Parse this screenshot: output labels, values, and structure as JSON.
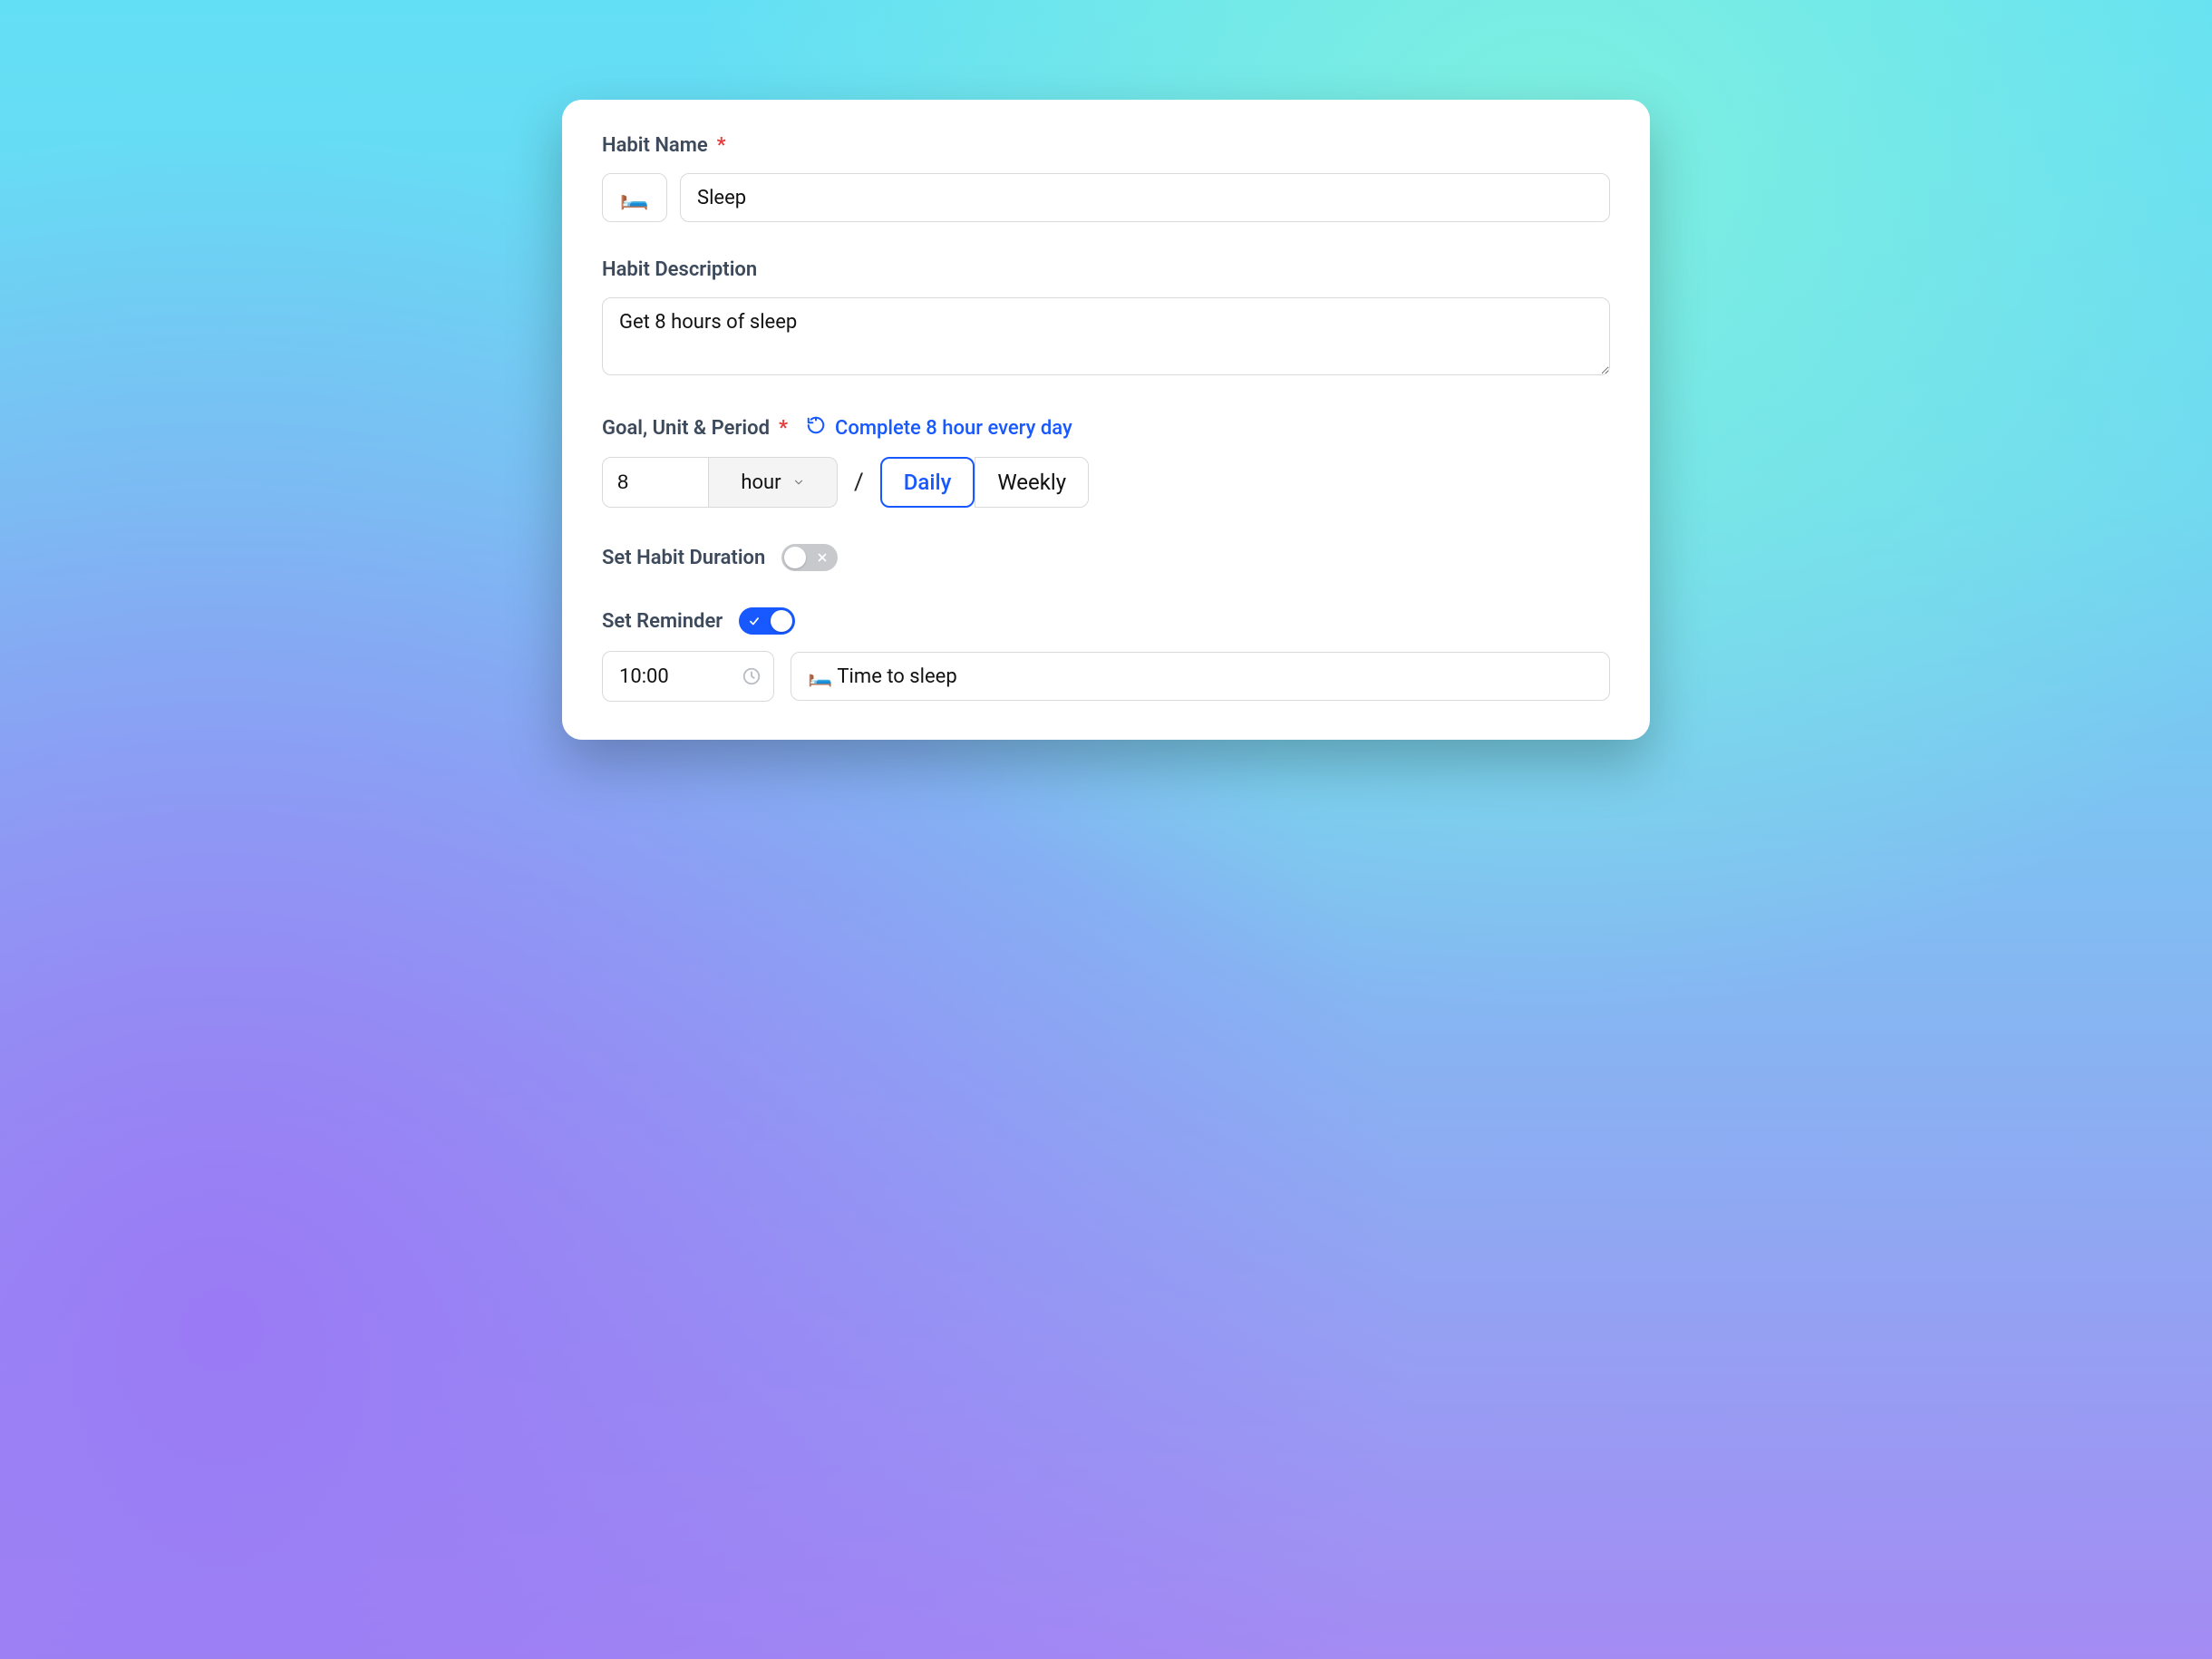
{
  "habit_name": {
    "label": "Habit Name",
    "icon_emoji": "🛏️",
    "value": "Sleep"
  },
  "habit_description": {
    "label": "Habit Description",
    "value": "Get 8 hours of sleep"
  },
  "goal": {
    "label": "Goal, Unit & Period",
    "summary": "Complete 8 hour every day",
    "value": "8",
    "unit": "hour",
    "separator": "/",
    "period_options": [
      "Daily",
      "Weekly"
    ],
    "period_selected": "Daily"
  },
  "duration": {
    "label": "Set Habit Duration",
    "enabled": false
  },
  "reminder": {
    "label": "Set Reminder",
    "enabled": true,
    "time": "10:00",
    "message": "🛏️ Time to sleep"
  }
}
